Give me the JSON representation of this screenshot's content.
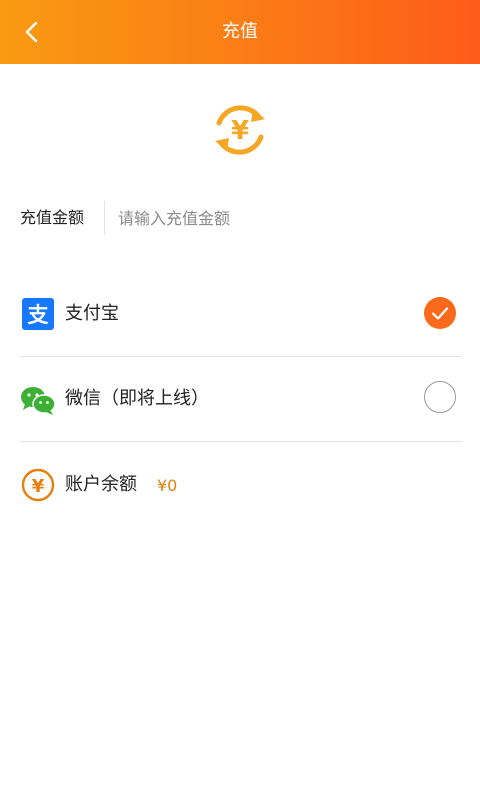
{
  "header": {
    "title": "充值",
    "back_icon": "chevron-left-icon",
    "gradient_colors": [
      "#f99a12",
      "#fe5b1a"
    ]
  },
  "hero": {
    "icon": "yuan-exchange-icon",
    "accent": "#f5a623"
  },
  "amount": {
    "label": "充值金额",
    "placeholder": "请输入充值金额",
    "value": ""
  },
  "payment_methods": [
    {
      "label": "支付宝",
      "icon": "alipay-icon",
      "selected": true,
      "brand_color": "#1677ff"
    },
    {
      "label": "微信（即将上线）",
      "icon": "wechat-icon",
      "selected": false,
      "brand_color": "#3cb034"
    }
  ],
  "balance": {
    "label": "账户余额",
    "value": "¥0",
    "icon": "yuan-coin-icon",
    "accent": "#e5800f"
  },
  "colors": {
    "accent": "#fb6a1a"
  }
}
